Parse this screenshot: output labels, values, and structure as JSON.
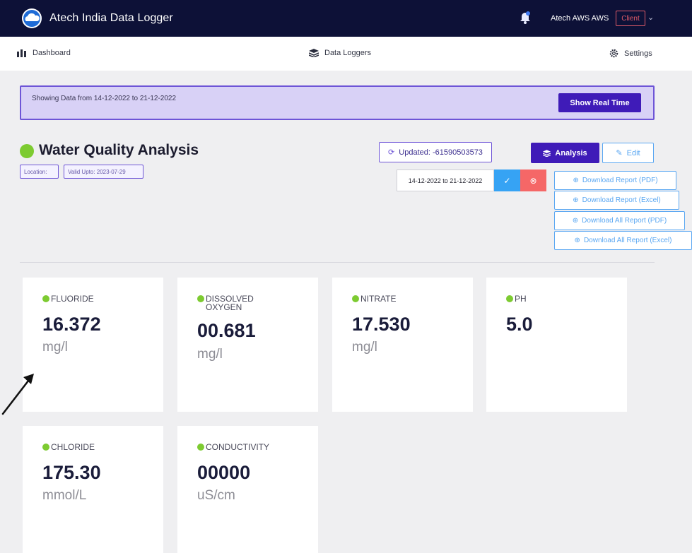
{
  "app": {
    "title": "Atech India Data Logger",
    "user_name": "Atech AWS AWS",
    "role": "Client"
  },
  "nav": {
    "dashboard": "Dashboard",
    "data_loggers": "Data Loggers",
    "settings": "Settings"
  },
  "banner": {
    "text": "Showing Data from 14-12-2022 to 21-12-2022",
    "button": "Show Real Time"
  },
  "header": {
    "title": "Water Quality Analysis",
    "location_label": "Location:",
    "valid_upto": "Valid Upto: 2023-07-29",
    "updated": "Updated: -61590503573",
    "analysis_button": "Analysis",
    "edit_button": "Edit",
    "date_range": "14-12-2022 to 21-12-2022"
  },
  "downloads": [
    "Download Report (PDF)",
    "Download Report (Excel)",
    "Download All Report (PDF)",
    "Download All Report (Excel)"
  ],
  "sensors": [
    {
      "label": "FLUORIDE",
      "value": "16.372",
      "unit": "mg/l"
    },
    {
      "label": "DISSOLVED OXYGEN",
      "value": "00.681",
      "unit": "mg/l"
    },
    {
      "label": "NITRATE",
      "value": "17.530",
      "unit": "mg/l"
    },
    {
      "label": "PH",
      "value": "5.0",
      "unit": ""
    },
    {
      "label": "CHLORIDE",
      "value": "175.30",
      "unit": "mmol/L"
    },
    {
      "label": "CONDUCTIVITY",
      "value": "00000",
      "unit": "uS/cm"
    }
  ],
  "colors": {
    "topbar": "#0d1137",
    "primary": "#3f1bb8",
    "accent_blue": "#5aa7f2",
    "status_green": "#7dcb31",
    "danger": "#f56767",
    "banner_bg": "#d8d1f6"
  },
  "icons": {
    "logo": "cloud-logo-icon",
    "notification": "bell-icon",
    "dashboard": "bar-chart-icon",
    "data_loggers": "stack-icon",
    "settings": "gear-icon",
    "updated": "refresh-icon",
    "analysis": "stack-icon",
    "edit": "pencil-icon",
    "apply": "check-circle-icon",
    "clear": "close-circle-icon",
    "download": "download-icon"
  }
}
